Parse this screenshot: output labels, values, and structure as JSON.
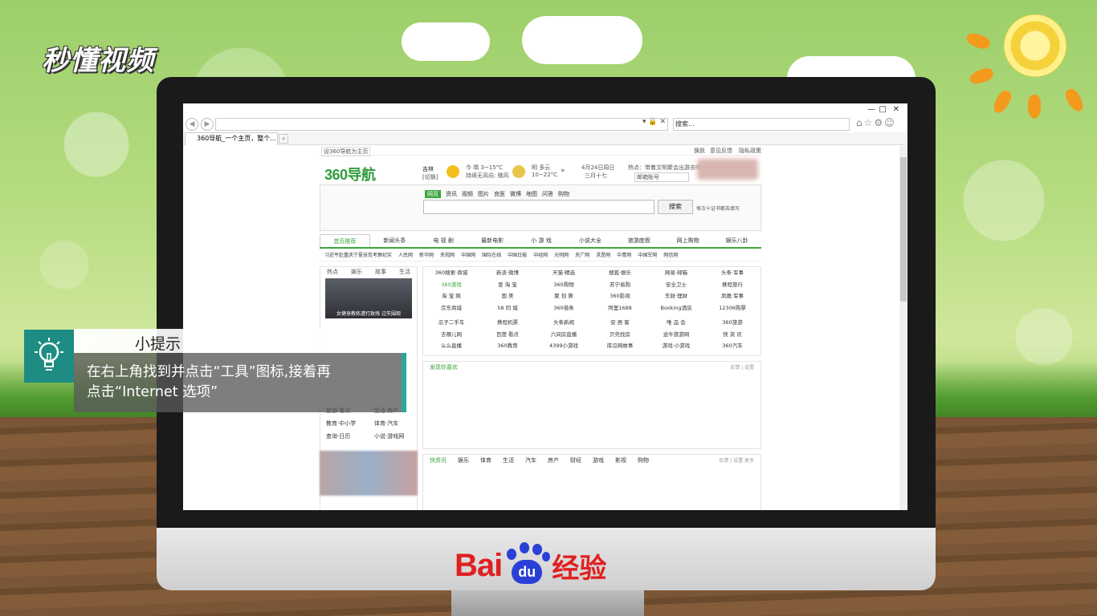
{
  "brand_top": "秒懂视频",
  "brand_bottom": {
    "bai": "Bai",
    "du": "du",
    "jingyan": "经验"
  },
  "browser": {
    "search_placeholder": "搜索...",
    "tab_title": "360导航_一个主页，整个...",
    "window_controls": [
      "—",
      "□",
      "✕"
    ],
    "set_home": "设360导航为主页"
  },
  "nav360": {
    "logo": "360导航",
    "util_links": [
      "换肤",
      "意见反馈",
      "隐私政策"
    ],
    "city": "吉林",
    "city_switch": "[切换]",
    "weather_today": "今 晴 3~15°C",
    "weather_today_sub": "持续无风向: 微风",
    "weather_tomorrow": "明 多云",
    "weather_tomorrow_temp": "10~22°C",
    "date": "4月24日周日",
    "lunar": "三月十七",
    "hot": "热点：带着文明聚会出游去吧",
    "mail": "邮箱账号",
    "search_tabs": [
      "网页",
      "资讯",
      "视频",
      "图片",
      "良医",
      "微博",
      "地图",
      "问答",
      "购物"
    ],
    "search_button": "搜索",
    "search_hint": "每次十证书都去填写",
    "categories": [
      "首页推荐",
      "新闻头条",
      "电 视 剧",
      "最新电影",
      "小 游 戏",
      "小说大全",
      "旅游度假",
      "网上购物",
      "娱乐八卦"
    ],
    "newsline": [
      "习近平赴重庆宁夏扶贫考察纪实",
      "人民网",
      "新华网",
      "央视网",
      "中国网",
      "国际在线",
      "中国日报",
      "中经网",
      "光明网",
      "央广网",
      "求是网",
      "中青网",
      "中国军网",
      "网信网"
    ],
    "left_tabs": [
      "热点",
      "娱乐",
      "故事",
      "生活"
    ],
    "photo_caption": "女健身教练遭打致残 过失围观",
    "left_links": [
      [
        "旅游·看点",
        "生活·房产"
      ],
      [
        "教育·中小学",
        "体育·汽车"
      ],
      [
        "查询·日历",
        "小说·游戏网"
      ]
    ],
    "sites": [
      [
        "360搜索·商城",
        "新浪·微博",
        "天猫·精选",
        "搜狐·娱乐",
        "网易·邮箱",
        "头条·军事"
      ],
      [
        "360游戏",
        "爱 淘 宝",
        "360购物",
        "苏宁易购",
        "安全卫士",
        "携程旅行"
      ],
      [
        "淘 宝 网",
        "国 美",
        "聚 划 算",
        "360影视",
        "东财·理财",
        "凤凰·军事"
      ],
      [
        "京东商城",
        "58 同 城",
        "360借条",
        "阿里1688",
        "Booking酒店",
        "12306购票"
      ],
      [
        "瓜子二手车",
        "携程机票",
        "头条新闻",
        "安 居 客",
        "唯 品 会",
        "360旅游"
      ],
      [
        "去哪儿网",
        "百度·看点",
        "六间房直播",
        "贝壳找房",
        "途牛旅游网",
        "快 资 讯"
      ],
      [
        "么么直播",
        "360教育",
        "4399小游戏",
        "库瓜网故事",
        "游戏·小游戏",
        "360汽车"
      ]
    ],
    "panel1_title": "发现你喜欢",
    "panel1_actions": "反馈 | 设置",
    "panel2_tabs": [
      "快资讯",
      "娱乐",
      "体育",
      "生活",
      "汽车",
      "房产",
      "财经",
      "游戏",
      "影视",
      "购物"
    ],
    "panel2_actions": "反馈 | 设置  更多"
  },
  "tip": {
    "title": "小提示",
    "line1": "在右上角找到并点击“工具”图标,接着再",
    "line2": "点击“Internet 选项”"
  }
}
